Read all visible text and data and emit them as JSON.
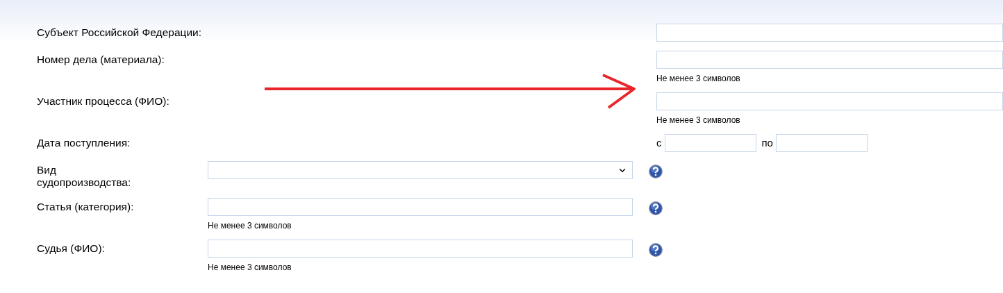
{
  "upper_fields": [
    {
      "kind": "text",
      "label": "Субъект Российской Федерации:"
    },
    {
      "kind": "text",
      "label": "Номер дела (материала):",
      "hint": "Не менее 3 символов"
    },
    {
      "kind": "text",
      "label": "Участник процесса (ФИО):",
      "hint": "Не менее 3 символов"
    },
    {
      "kind": "date_range",
      "label": "Дата поступления:",
      "from_label": "с",
      "to_label": "по"
    }
  ],
  "lower_fields": [
    {
      "kind": "select",
      "label": "Вид судопроизводства:"
    },
    {
      "kind": "text",
      "label": "Статья (категория):",
      "hint": "Не менее 3 символов"
    },
    {
      "kind": "text",
      "label": "Судья (ФИО):",
      "hint": "Не менее 3 символов"
    }
  ],
  "annotation": {
    "kind": "arrow"
  }
}
